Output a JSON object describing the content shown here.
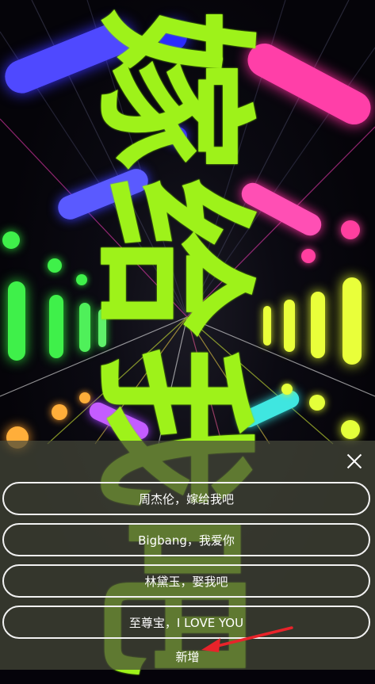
{
  "display": {
    "scrolling_text": "，嫁给我吧",
    "text_color": "#9ef21a"
  },
  "sheet": {
    "close_icon": "close-icon",
    "options": [
      {
        "label": "周杰伦，嫁给我吧"
      },
      {
        "label": "Bigbang，我爱你"
      },
      {
        "label": "林黛玉，娶我吧"
      },
      {
        "label": "至尊宝，I LOVE YOU"
      }
    ],
    "add_label": "新增"
  },
  "annotation": {
    "arrow_color": "#e8232a"
  }
}
